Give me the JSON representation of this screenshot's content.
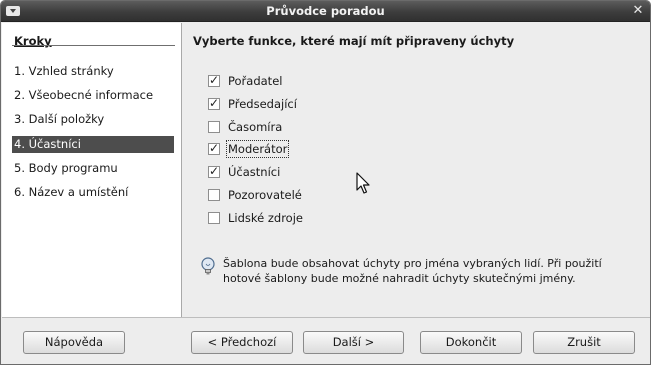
{
  "window": {
    "title": "Průvodce poradou"
  },
  "sidebar": {
    "heading": "Kroky",
    "steps": [
      {
        "label": "1. Vzhled stránky",
        "active": false
      },
      {
        "label": "2. Všeobecné informace",
        "active": false
      },
      {
        "label": "3. Další položky",
        "active": false
      },
      {
        "label": "4. Účastníci",
        "active": true
      },
      {
        "label": "5. Body programu",
        "active": false
      },
      {
        "label": "6. Název a umístění",
        "active": false
      }
    ]
  },
  "main": {
    "heading": "Vyberte funkce, které mají mít připraveny úchyty",
    "options": [
      {
        "label": "Pořadatel",
        "checked": true
      },
      {
        "label": "Předsedající",
        "checked": true
      },
      {
        "label": "Časomíra",
        "checked": false
      },
      {
        "label": "Moderátor",
        "checked": true,
        "focused": true
      },
      {
        "label": "Účastníci",
        "checked": true
      },
      {
        "label": "Pozorovatelé",
        "checked": false
      },
      {
        "label": "Lidské zdroje",
        "checked": false
      }
    ],
    "info_icon": "lightbulb-icon",
    "info_text": "Šablona bude obsahovat úchyty pro jména vybraných lidí. Při použití hotové šablony bude možné nahradit úchyty skutečnými jmény."
  },
  "buttons": {
    "help": "Nápověda",
    "previous": "< Předchozí",
    "next": "Další >",
    "finish": "Dokončit",
    "cancel": "Zrušit"
  },
  "colors": {
    "titlebar": "#3d3d3d",
    "active_step": "#4d4d4d",
    "panel": "#ededed"
  }
}
